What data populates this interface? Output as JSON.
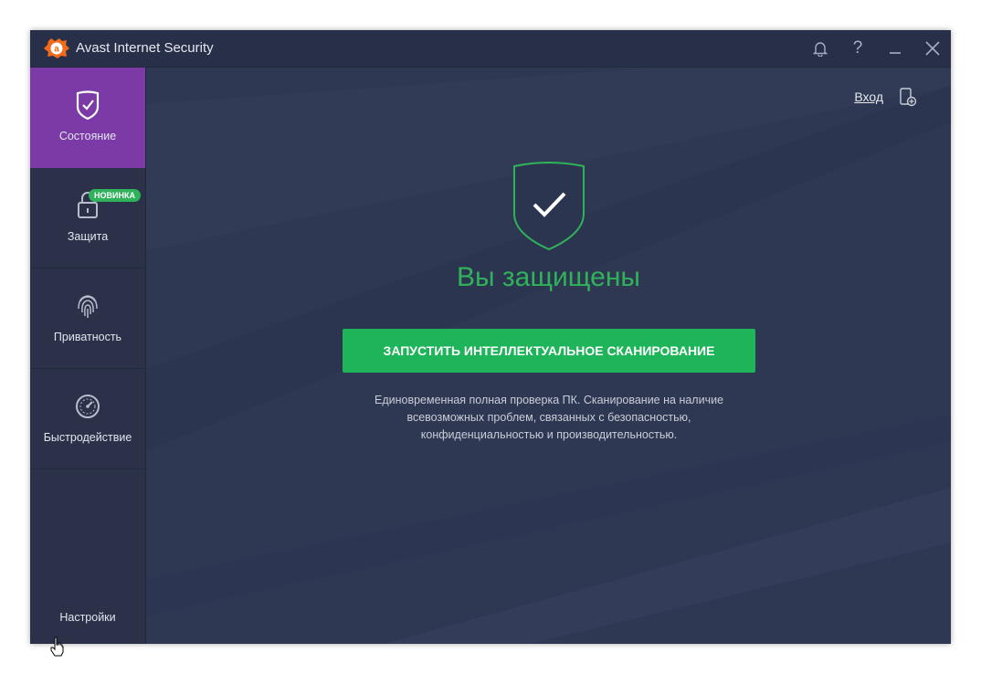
{
  "app": {
    "title": "Avast Internet Security"
  },
  "titlebar": {
    "icons": [
      "bell-icon",
      "help-icon",
      "minimize-icon",
      "close-icon"
    ],
    "help_glyph": "?",
    "close_glyph": "✕"
  },
  "sidebar": {
    "items": [
      {
        "label": "Состояние",
        "icon": "shield-check-icon",
        "active": true
      },
      {
        "label": "Защита",
        "icon": "lock-icon",
        "badge": "НОВИНКА"
      },
      {
        "label": "Приватность",
        "icon": "fingerprint-icon"
      },
      {
        "label": "Быстродействие",
        "icon": "speedometer-icon"
      }
    ],
    "settings_label": "Настройки"
  },
  "main": {
    "login_label": "Вход",
    "status_title": "Вы защищены",
    "scan_button_label": "ЗАПУСТИТЬ ИНТЕЛЛЕКТУАЛЬНОЕ СКАНИРОВАНИЕ",
    "description_lines": [
      "Единовременная полная проверка ПК. Сканирование на наличие",
      "всевозможных проблем, связанных с безопасностью,",
      "конфиденциальностью и производительностью."
    ]
  },
  "colors": {
    "accent_purple": "#7b3aa6",
    "status_green": "#2fb25a",
    "button_green": "#1eb45a",
    "background": "#2f3853",
    "logo_orange": "#f26b1d"
  }
}
